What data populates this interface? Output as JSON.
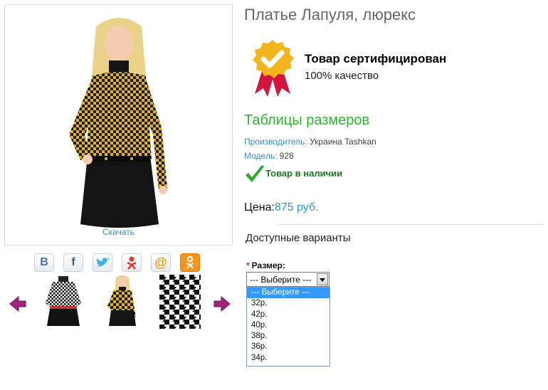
{
  "product": {
    "title": "Платье Лапуля, люрекс",
    "download_label": "Скачать",
    "certified_title": "Товар сертифицирован",
    "certified_sub": "100% качество",
    "size_table_link": "Таблицы размеров",
    "manufacturer_label": "Производитель:",
    "manufacturer_value": " Украина Tashkan",
    "model_label": "Модель:",
    "model_value": " 928",
    "stock_status": "Товар в наличии",
    "price_label": "Цена:",
    "price_value": "875 руб."
  },
  "share_icons": [
    "vk-icon",
    "facebook-icon",
    "twitter-icon",
    "odnoklassniki-icon",
    "mail-ru-icon",
    "ok-icon"
  ],
  "thumbnails": [
    "thumb-dress-black-white",
    "thumb-dress-yellow",
    "thumb-houndstooth-fabric"
  ],
  "options": {
    "section_title": "Доступные варианты",
    "size_label": "Размер:",
    "required_mark": "*",
    "select_value": "--- Выберите ---",
    "size_options": [
      "--- Выберите ---",
      "32р.",
      "42р.",
      "40р.",
      "38р.",
      "36р.",
      "34р."
    ]
  },
  "colors": {
    "accent_blue": "#3a8fc7",
    "green": "#2fb52f",
    "price_blue": "#2a96d3",
    "gold": "#f2b51d",
    "ribbon": "#d0163c"
  }
}
